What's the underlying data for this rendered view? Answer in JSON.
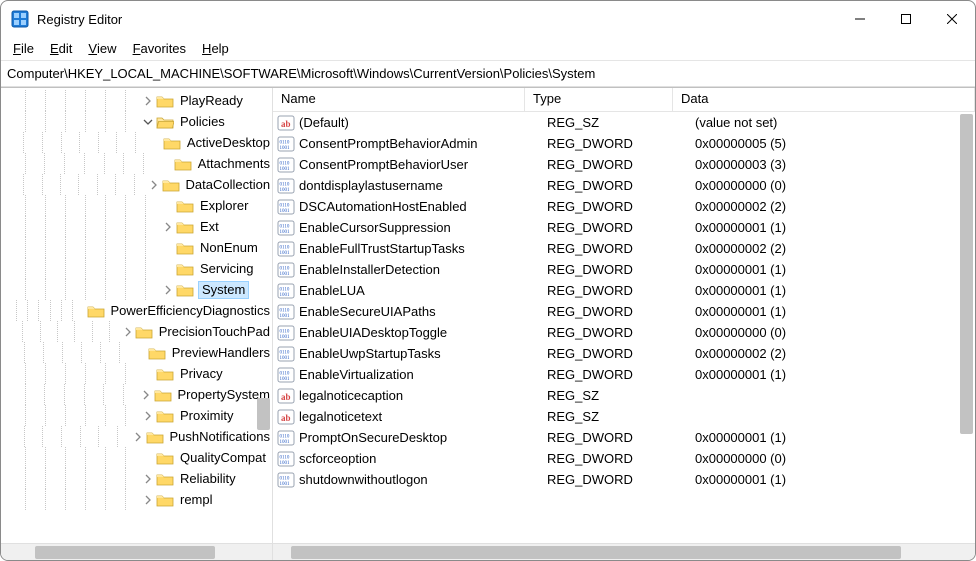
{
  "window": {
    "title": "Registry Editor"
  },
  "menu": {
    "file": "File",
    "edit": "Edit",
    "view": "View",
    "favorites": "Favorites",
    "help": "Help"
  },
  "address": "Computer\\HKEY_LOCAL_MACHINE\\SOFTWARE\\Microsoft\\Windows\\CurrentVersion\\Policies\\System",
  "tree": [
    {
      "depth": 7,
      "expander": "closed",
      "label": "PlayReady",
      "selected": false
    },
    {
      "depth": 7,
      "expander": "open",
      "label": "Policies",
      "selected": false
    },
    {
      "depth": 8,
      "expander": "none",
      "label": "ActiveDesktop",
      "selected": false
    },
    {
      "depth": 8,
      "expander": "none",
      "label": "Attachments",
      "selected": false
    },
    {
      "depth": 8,
      "expander": "closed",
      "label": "DataCollection",
      "selected": false
    },
    {
      "depth": 8,
      "expander": "none",
      "label": "Explorer",
      "selected": false
    },
    {
      "depth": 8,
      "expander": "closed",
      "label": "Ext",
      "selected": false
    },
    {
      "depth": 8,
      "expander": "none",
      "label": "NonEnum",
      "selected": false
    },
    {
      "depth": 8,
      "expander": "none",
      "label": "Servicing",
      "selected": false
    },
    {
      "depth": 8,
      "expander": "closed",
      "label": "System",
      "selected": true
    },
    {
      "depth": 7,
      "expander": "none",
      "label": "PowerEfficiencyDiagnostics",
      "selected": false
    },
    {
      "depth": 7,
      "expander": "closed",
      "label": "PrecisionTouchPad",
      "selected": false
    },
    {
      "depth": 7,
      "expander": "none",
      "label": "PreviewHandlers",
      "selected": false
    },
    {
      "depth": 7,
      "expander": "none",
      "label": "Privacy",
      "selected": false
    },
    {
      "depth": 7,
      "expander": "closed",
      "label": "PropertySystem",
      "selected": false
    },
    {
      "depth": 7,
      "expander": "closed",
      "label": "Proximity",
      "selected": false
    },
    {
      "depth": 7,
      "expander": "closed",
      "label": "PushNotifications",
      "selected": false
    },
    {
      "depth": 7,
      "expander": "none",
      "label": "QualityCompat",
      "selected": false
    },
    {
      "depth": 7,
      "expander": "closed",
      "label": "Reliability",
      "selected": false
    },
    {
      "depth": 7,
      "expander": "closed",
      "label": "rempl",
      "selected": false
    }
  ],
  "list": {
    "columns": {
      "name": "Name",
      "type": "Type",
      "data": "Data"
    },
    "rows": [
      {
        "icon": "sz",
        "name": "(Default)",
        "type": "REG_SZ",
        "data": "(value not set)"
      },
      {
        "icon": "dword",
        "name": "ConsentPromptBehaviorAdmin",
        "type": "REG_DWORD",
        "data": "0x00000005 (5)"
      },
      {
        "icon": "dword",
        "name": "ConsentPromptBehaviorUser",
        "type": "REG_DWORD",
        "data": "0x00000003 (3)"
      },
      {
        "icon": "dword",
        "name": "dontdisplaylastusername",
        "type": "REG_DWORD",
        "data": "0x00000000 (0)"
      },
      {
        "icon": "dword",
        "name": "DSCAutomationHostEnabled",
        "type": "REG_DWORD",
        "data": "0x00000002 (2)"
      },
      {
        "icon": "dword",
        "name": "EnableCursorSuppression",
        "type": "REG_DWORD",
        "data": "0x00000001 (1)"
      },
      {
        "icon": "dword",
        "name": "EnableFullTrustStartupTasks",
        "type": "REG_DWORD",
        "data": "0x00000002 (2)"
      },
      {
        "icon": "dword",
        "name": "EnableInstallerDetection",
        "type": "REG_DWORD",
        "data": "0x00000001 (1)"
      },
      {
        "icon": "dword",
        "name": "EnableLUA",
        "type": "REG_DWORD",
        "data": "0x00000001 (1)"
      },
      {
        "icon": "dword",
        "name": "EnableSecureUIAPaths",
        "type": "REG_DWORD",
        "data": "0x00000001 (1)"
      },
      {
        "icon": "dword",
        "name": "EnableUIADesktopToggle",
        "type": "REG_DWORD",
        "data": "0x00000000 (0)"
      },
      {
        "icon": "dword",
        "name": "EnableUwpStartupTasks",
        "type": "REG_DWORD",
        "data": "0x00000002 (2)"
      },
      {
        "icon": "dword",
        "name": "EnableVirtualization",
        "type": "REG_DWORD",
        "data": "0x00000001 (1)"
      },
      {
        "icon": "sz",
        "name": "legalnoticecaption",
        "type": "REG_SZ",
        "data": ""
      },
      {
        "icon": "sz",
        "name": "legalnoticetext",
        "type": "REG_SZ",
        "data": ""
      },
      {
        "icon": "dword",
        "name": "PromptOnSecureDesktop",
        "type": "REG_DWORD",
        "data": "0x00000001 (1)"
      },
      {
        "icon": "dword",
        "name": "scforceoption",
        "type": "REG_DWORD",
        "data": "0x00000000 (0)"
      },
      {
        "icon": "dword",
        "name": "shutdownwithoutlogon",
        "type": "REG_DWORD",
        "data": "0x00000001 (1)"
      }
    ]
  }
}
